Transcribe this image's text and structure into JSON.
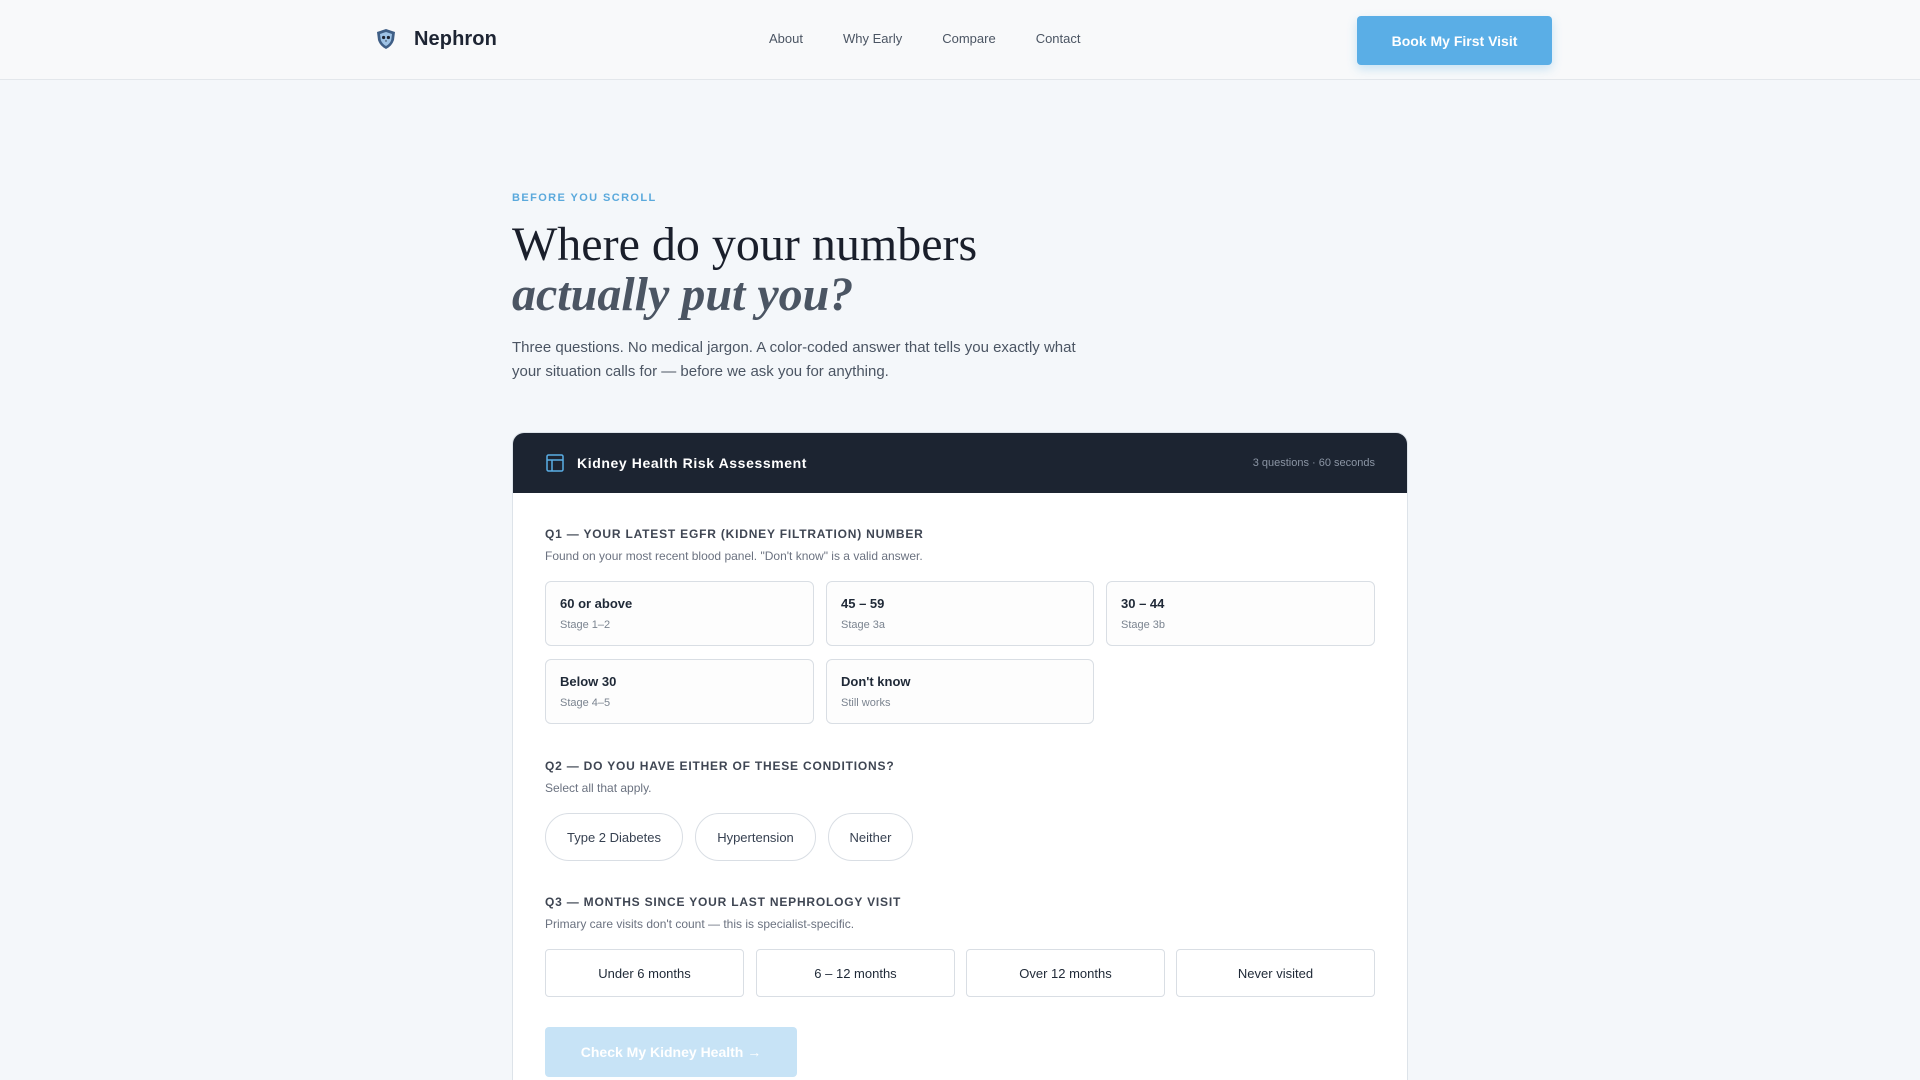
{
  "brand": {
    "name": "Nephron",
    "logo_icon": "shield-owl-icon"
  },
  "nav": {
    "items": [
      "About",
      "Why Early",
      "Compare",
      "Contact"
    ]
  },
  "header_cta": "Book My First Visit",
  "hero": {
    "eyebrow": "BEFORE YOU SCROLL",
    "title_line1": "Where do your numbers",
    "title_line2": "actually put you?",
    "lede": "Three questions. No medical jargon. A color-coded answer that tells you exactly what your situation calls for — before we ask you for anything."
  },
  "assessment": {
    "title": "Kidney Health Risk Assessment",
    "meta": "3 questions · 60 seconds",
    "q1": {
      "label": "Q1 — YOUR LATEST EGFR (KIDNEY FILTRATION) NUMBER",
      "hint": "Found on your most recent blood panel. \"Don't know\" is a valid answer.",
      "options": [
        {
          "title": "60 or above",
          "sub": "Stage 1–2"
        },
        {
          "title": "45 – 59",
          "sub": "Stage 3a"
        },
        {
          "title": "30 – 44",
          "sub": "Stage 3b"
        },
        {
          "title": "Below 30",
          "sub": "Stage 4–5"
        },
        {
          "title": "Don't know",
          "sub": "Still works"
        }
      ]
    },
    "q2": {
      "label": "Q2 — DO YOU HAVE EITHER OF THESE CONDITIONS?",
      "hint": "Select all that apply.",
      "options": [
        "Type 2 Diabetes",
        "Hypertension",
        "Neither"
      ]
    },
    "q3": {
      "label": "Q3 — MONTHS SINCE YOUR LAST NEPHROLOGY VISIT",
      "hint": "Primary care visits don't count — this is specialist-specific.",
      "options": [
        "Under 6 months",
        "6 – 12 months",
        "Over 12 months",
        "Never visited"
      ]
    },
    "submit": "Check My Kidney Health →"
  },
  "colors": {
    "accent": "#5aaee6",
    "card_header": "#1c2431",
    "submit_disabled": "#c7e3f6"
  }
}
